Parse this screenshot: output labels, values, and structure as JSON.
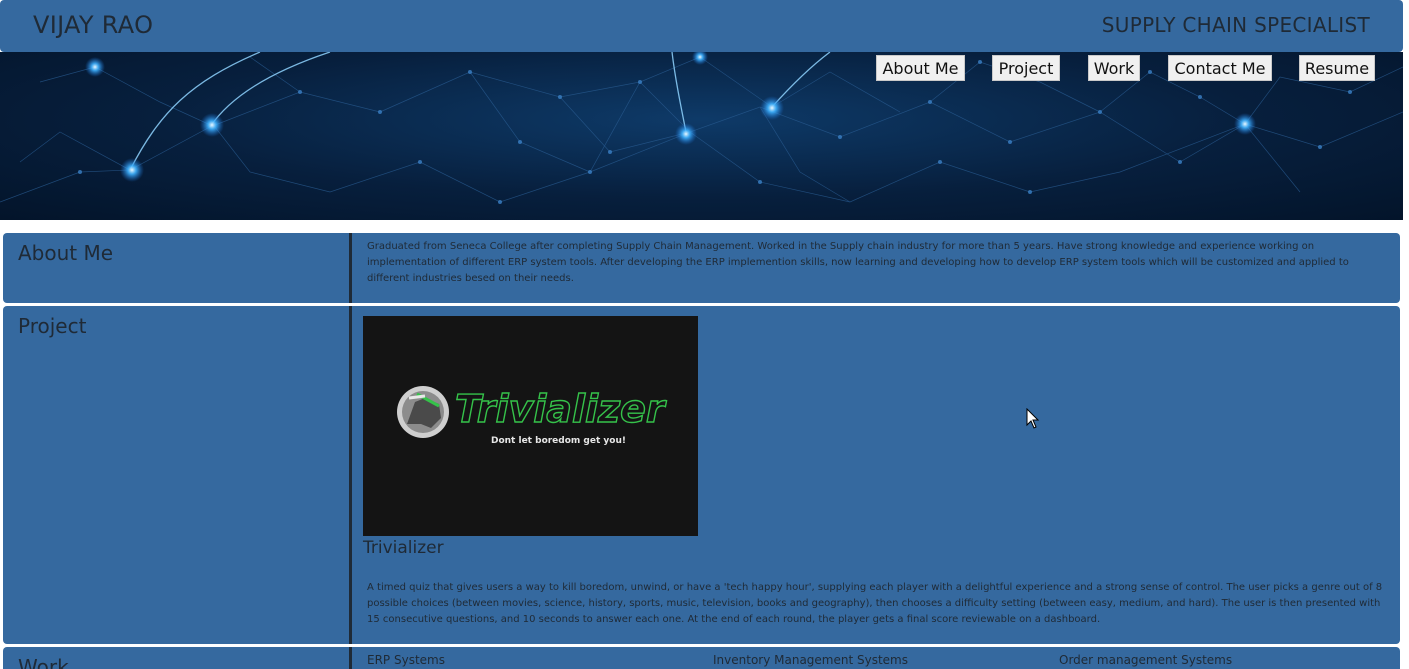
{
  "header": {
    "name": "VIJAY RAO",
    "tagline": "SUPPLY CHAIN SPECIALIST"
  },
  "nav": {
    "items": [
      {
        "label": "About Me"
      },
      {
        "label": "Project"
      },
      {
        "label": "Work"
      },
      {
        "label": "Contact Me"
      },
      {
        "label": "Resume"
      }
    ]
  },
  "about": {
    "heading": "About Me",
    "text": "Graduated from Seneca College after completing Supply Chain Management. Worked in the Supply chain industry for more than 5 years. Have strong knowledge and experience working on implementation of different ERP system tools. After developing the ERP implemention skills, now learning and developing how to develop ERP system tools which will be customized and applied to different industries besed on their needs."
  },
  "project": {
    "heading": "Project",
    "logo_title": "Trivializer",
    "logo_slogan": "Dont let boredom get you!",
    "title": "Trivializer",
    "description": "A timed quiz that gives users a way to kill boredom, unwind, or have a 'tech happy hour', supplying each player with a delightful experience and a strong sense of control. The user picks a genre out of 8 possible choices (between movies, science, history, sports, music, television, books and geography), then chooses a difficulty setting (between easy, medium, and hard). The user is then presented with 15 consecutive questions, and 10 seconds to answer each one. At the end of each round, the player gets a final score reviewable on a dashboard."
  },
  "work": {
    "heading": "Work",
    "columns": [
      "ERP Systems",
      "Inventory Management Systems",
      "Order management Systems"
    ]
  },
  "colors": {
    "primary": "#35699f",
    "text": "#1f2a36",
    "logo_green": "#35c24a"
  }
}
